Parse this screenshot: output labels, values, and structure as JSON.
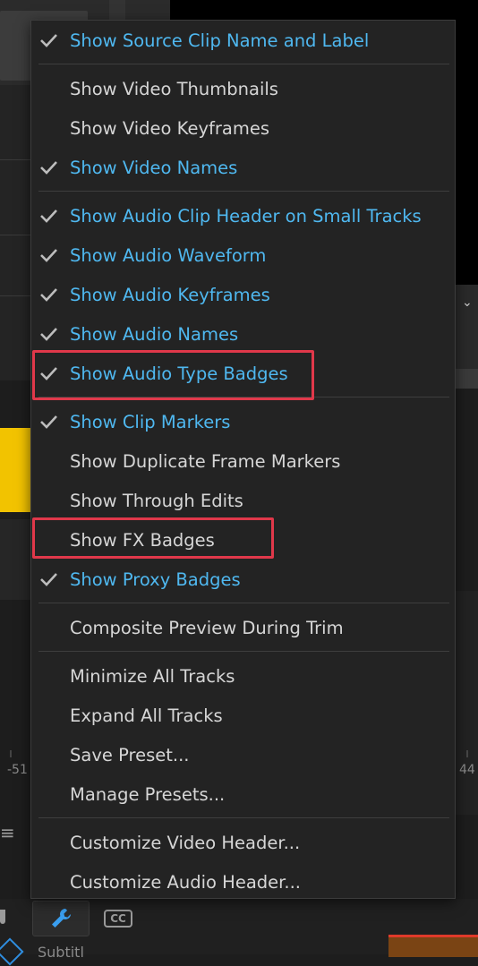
{
  "menu": {
    "items": [
      {
        "label": "Show Source Clip Name and Label",
        "checked": true
      },
      {
        "label": "Show Video Thumbnails",
        "checked": false
      },
      {
        "label": "Show Video Keyframes",
        "checked": false
      },
      {
        "label": "Show Video Names",
        "checked": true
      },
      {
        "label": "Show Audio Clip Header on Small Tracks",
        "checked": true
      },
      {
        "label": "Show Audio Waveform",
        "checked": true
      },
      {
        "label": "Show Audio Keyframes",
        "checked": true
      },
      {
        "label": "Show Audio Names",
        "checked": true
      },
      {
        "label": "Show Audio Type Badges",
        "checked": true,
        "highlighted": true
      },
      {
        "label": "Show Clip Markers",
        "checked": true
      },
      {
        "label": "Show Duplicate Frame Markers",
        "checked": false
      },
      {
        "label": "Show Through Edits",
        "checked": false
      },
      {
        "label": "Show FX Badges",
        "checked": false,
        "highlighted": true
      },
      {
        "label": "Show Proxy Badges",
        "checked": true
      },
      {
        "label": "Composite Preview During Trim",
        "checked": false
      },
      {
        "label": "Minimize All Tracks",
        "checked": false
      },
      {
        "label": "Expand All Tracks",
        "checked": false
      },
      {
        "label": "Save Preset...",
        "checked": false
      },
      {
        "label": "Manage Presets...",
        "checked": false
      },
      {
        "label": "Customize Video Header...",
        "checked": false
      },
      {
        "label": "Customize Audio Header...",
        "checked": false
      }
    ]
  },
  "background": {
    "ruler_left": "-51",
    "ruler_right": "44",
    "cc_label": "CC",
    "subtitle_fragment": "Subtitl"
  },
  "colors": {
    "checked_text": "#4fb8f0",
    "unchecked_text": "#d6d6d6",
    "menu_bg": "#232323",
    "highlight_box": "#e0384a",
    "accent_blue": "#2f8ee0",
    "track_yellow": "#f2c300"
  },
  "icons": {
    "check": "checkmark-icon",
    "wrench": "wrench-icon",
    "cc": "closed-captions-icon",
    "menu": "hamburger-menu-icon"
  }
}
